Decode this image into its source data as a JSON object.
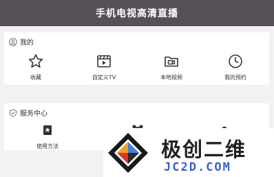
{
  "header": {
    "title": "手机电视高清直播"
  },
  "section_mine": {
    "title": "我的",
    "header_icon": "user-icon",
    "items": [
      {
        "label": "收藏",
        "icon": "star-icon"
      },
      {
        "label": "自定义TV",
        "icon": "clapperboard-icon"
      },
      {
        "label": "本地视频",
        "icon": "video-folder-icon"
      },
      {
        "label": "我的预约",
        "icon": "clock-icon"
      }
    ]
  },
  "section_service": {
    "title": "服务中心",
    "header_icon": "shield-check-icon",
    "items": [
      {
        "label": "使用方法",
        "icon": "guide-book-icon"
      },
      {
        "label": "",
        "icon": "alarm-clock-icon"
      },
      {
        "label": "",
        "icon": "camera-icon"
      }
    ]
  },
  "watermark": {
    "top_text": "极创二维",
    "bottom_text": "JC2D.COM"
  },
  "colors": {
    "header_bg": "#575059",
    "page_bg": "#f2f1f4",
    "card_bg": "#ffffff",
    "watermark_blue": "#3a5fd6",
    "icon_color": "#333333"
  }
}
